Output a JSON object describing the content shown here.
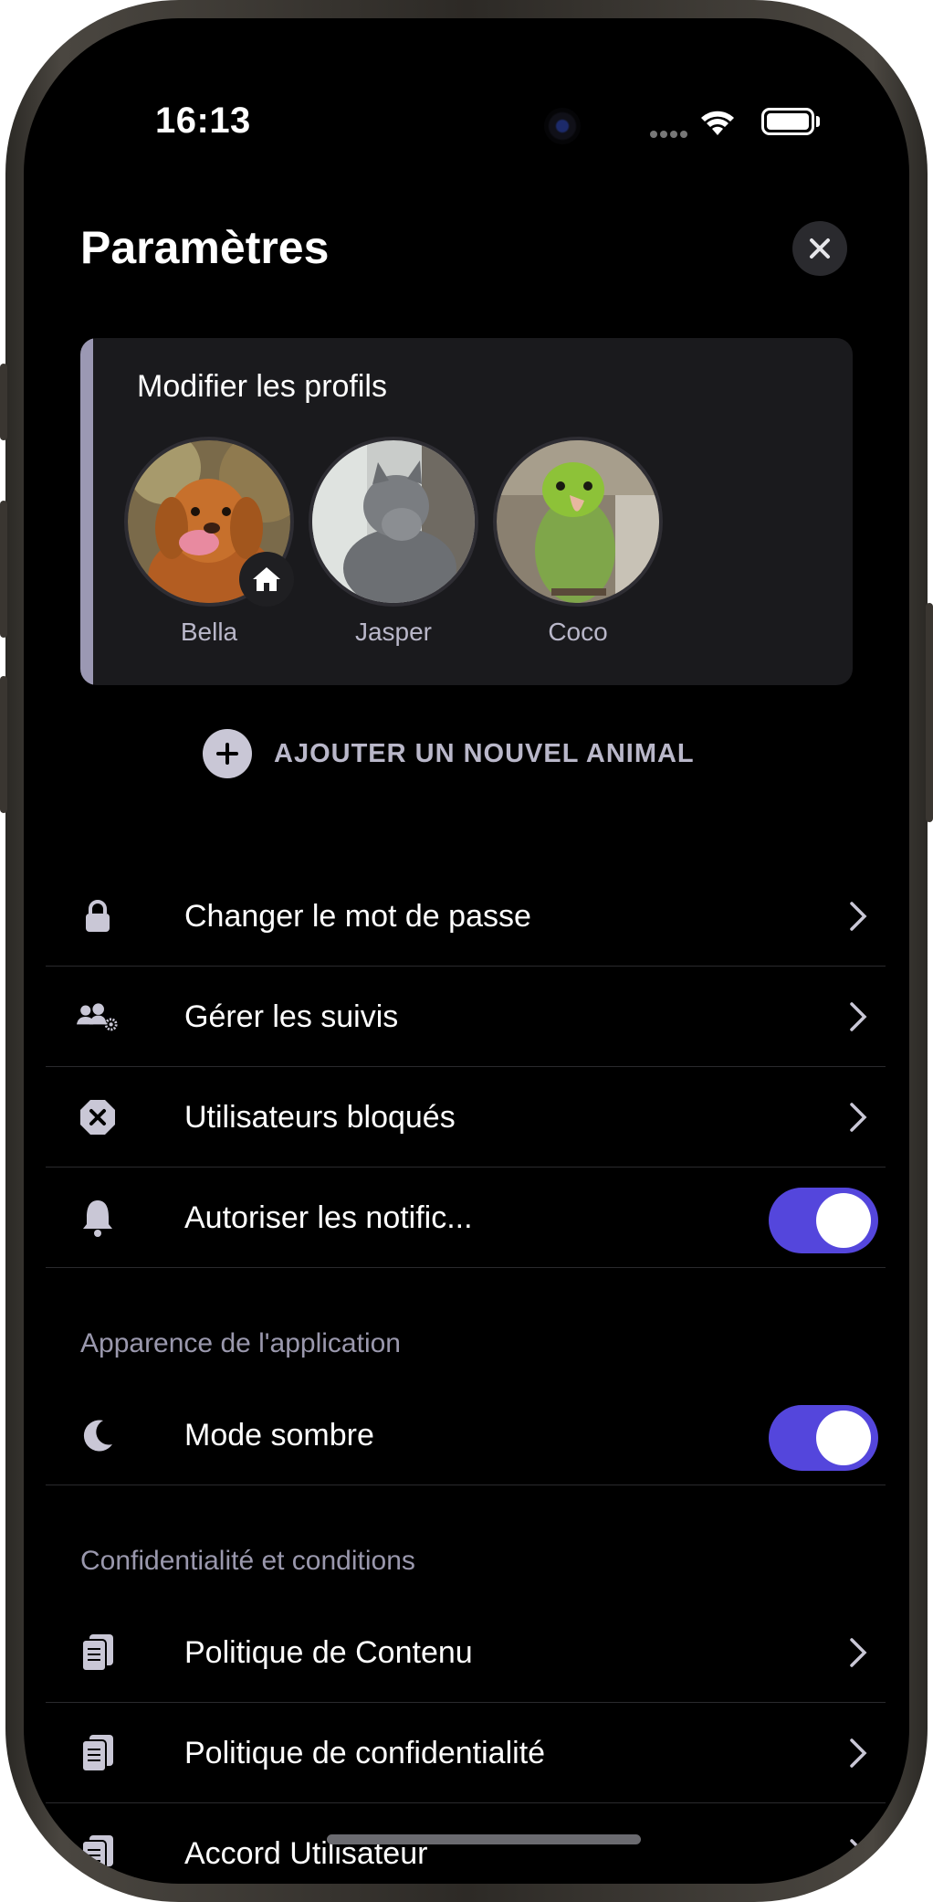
{
  "status_bar": {
    "time": "16:13"
  },
  "header": {
    "title": "Paramètres",
    "close_icon": "close-icon"
  },
  "profiles": {
    "title": "Modifier les profils",
    "pets": [
      {
        "name": "Bella",
        "home": true
      },
      {
        "name": "Jasper",
        "home": false
      },
      {
        "name": "Coco",
        "home": false
      }
    ]
  },
  "add_pet": {
    "label": "AJOUTER UN NOUVEL ANIMAL",
    "icon": "plus-circle-icon"
  },
  "account_rows": [
    {
      "label": "Changer le mot de passe",
      "icon": "lock-icon",
      "control": "chevron"
    },
    {
      "label": "Gérer les suivis",
      "icon": "users-gear-icon",
      "control": "chevron"
    },
    {
      "label": "Utilisateurs bloqués",
      "icon": "blocked-icon",
      "control": "chevron"
    },
    {
      "label": "Autoriser les notific...",
      "icon": "bell-icon",
      "control": "toggle",
      "on": true
    }
  ],
  "appearance": {
    "section": "Apparence de l'application",
    "rows": [
      {
        "label": "Mode sombre",
        "icon": "moon-icon",
        "control": "toggle",
        "on": true
      }
    ]
  },
  "privacy": {
    "section": "Confidentialité et conditions",
    "rows": [
      {
        "label": "Politique de Contenu",
        "icon": "document-icon",
        "control": "chevron"
      },
      {
        "label": "Politique de confidentialité",
        "icon": "document-icon",
        "control": "chevron"
      },
      {
        "label": "Accord Utilisateur",
        "icon": "document-icon",
        "control": "chevron"
      }
    ]
  },
  "colors": {
    "accent": "#5446dc",
    "background": "#000000",
    "card": "#1a1a1d",
    "muted_text": "#9a98ad"
  }
}
